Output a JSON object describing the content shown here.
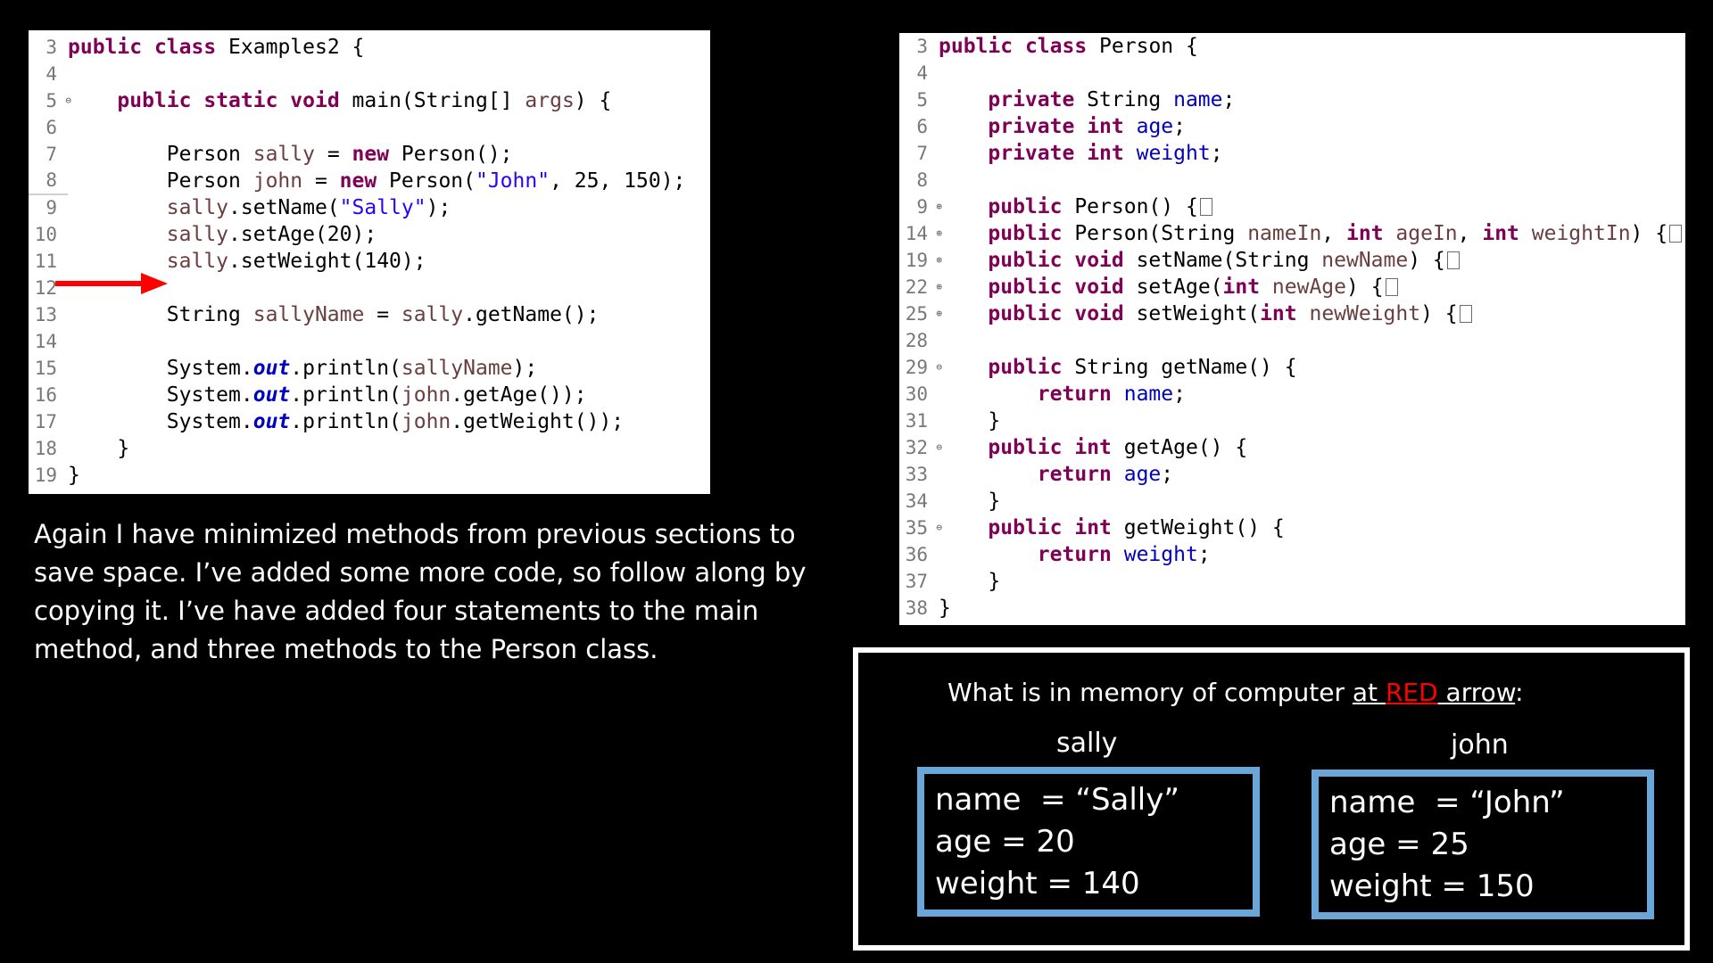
{
  "left_code": {
    "lines": [
      {
        "n": "3",
        "fold": "",
        "active": false,
        "tokens": [
          {
            "c": "kw",
            "t": "public"
          },
          {
            "c": "",
            "t": " "
          },
          {
            "c": "kw",
            "t": "class"
          },
          {
            "c": "",
            "t": " Examples2 {"
          }
        ]
      },
      {
        "n": "4",
        "fold": "",
        "active": false,
        "tokens": []
      },
      {
        "n": "5",
        "fold": "⊖",
        "active": false,
        "tokens": [
          {
            "c": "",
            "t": "    "
          },
          {
            "c": "kw",
            "t": "public"
          },
          {
            "c": "",
            "t": " "
          },
          {
            "c": "kw",
            "t": "static"
          },
          {
            "c": "",
            "t": " "
          },
          {
            "c": "kw",
            "t": "void"
          },
          {
            "c": "",
            "t": " main(String[] "
          },
          {
            "c": "var",
            "t": "args"
          },
          {
            "c": "",
            "t": ") {"
          }
        ]
      },
      {
        "n": "6",
        "fold": "",
        "active": false,
        "tokens": []
      },
      {
        "n": "7",
        "fold": "",
        "active": false,
        "tokens": [
          {
            "c": "",
            "t": "        Person "
          },
          {
            "c": "var",
            "t": "sally"
          },
          {
            "c": "",
            "t": " = "
          },
          {
            "c": "kw",
            "t": "new"
          },
          {
            "c": "",
            "t": " Person();"
          }
        ]
      },
      {
        "n": "8",
        "fold": "",
        "active": true,
        "tokens": [
          {
            "c": "",
            "t": "        Person "
          },
          {
            "c": "var",
            "t": "john"
          },
          {
            "c": "",
            "t": " = "
          },
          {
            "c": "kw",
            "t": "new"
          },
          {
            "c": "",
            "t": " Person("
          },
          {
            "c": "str",
            "t": "\"John\""
          },
          {
            "c": "",
            "t": ", 25, 150);"
          }
        ]
      },
      {
        "n": "9",
        "fold": "",
        "active": false,
        "tokens": [
          {
            "c": "",
            "t": "        "
          },
          {
            "c": "var",
            "t": "sally"
          },
          {
            "c": "",
            "t": ".setName("
          },
          {
            "c": "str",
            "t": "\"Sally\""
          },
          {
            "c": "",
            "t": ");"
          }
        ]
      },
      {
        "n": "10",
        "fold": "",
        "active": false,
        "tokens": [
          {
            "c": "",
            "t": "        "
          },
          {
            "c": "var",
            "t": "sally"
          },
          {
            "c": "",
            "t": ".setAge(20);"
          }
        ]
      },
      {
        "n": "11",
        "fold": "",
        "active": false,
        "tokens": [
          {
            "c": "",
            "t": "        "
          },
          {
            "c": "var",
            "t": "sally"
          },
          {
            "c": "",
            "t": ".setWeight(140);"
          }
        ]
      },
      {
        "n": "12",
        "fold": "",
        "active": false,
        "tokens": []
      },
      {
        "n": "13",
        "fold": "",
        "active": false,
        "tokens": [
          {
            "c": "",
            "t": "        String "
          },
          {
            "c": "var",
            "t": "sallyName"
          },
          {
            "c": "",
            "t": " = "
          },
          {
            "c": "var",
            "t": "sally"
          },
          {
            "c": "",
            "t": ".getName();"
          }
        ]
      },
      {
        "n": "14",
        "fold": "",
        "active": false,
        "tokens": []
      },
      {
        "n": "15",
        "fold": "",
        "active": false,
        "tokens": [
          {
            "c": "",
            "t": "        System."
          },
          {
            "c": "sfld",
            "t": "out"
          },
          {
            "c": "",
            "t": ".println("
          },
          {
            "c": "var",
            "t": "sallyName"
          },
          {
            "c": "",
            "t": ");"
          }
        ]
      },
      {
        "n": "16",
        "fold": "",
        "active": false,
        "tokens": [
          {
            "c": "",
            "t": "        System."
          },
          {
            "c": "sfld",
            "t": "out"
          },
          {
            "c": "",
            "t": ".println("
          },
          {
            "c": "var",
            "t": "john"
          },
          {
            "c": "",
            "t": ".getAge());"
          }
        ]
      },
      {
        "n": "17",
        "fold": "",
        "active": false,
        "tokens": [
          {
            "c": "",
            "t": "        System."
          },
          {
            "c": "sfld",
            "t": "out"
          },
          {
            "c": "",
            "t": ".println("
          },
          {
            "c": "var",
            "t": "john"
          },
          {
            "c": "",
            "t": ".getWeight());"
          }
        ]
      },
      {
        "n": "18",
        "fold": "",
        "active": false,
        "tokens": [
          {
            "c": "",
            "t": "    }"
          }
        ]
      },
      {
        "n": "19",
        "fold": "",
        "active": false,
        "tokens": [
          {
            "c": "",
            "t": "}"
          }
        ]
      }
    ]
  },
  "right_code": {
    "lines": [
      {
        "n": "3",
        "fold": "",
        "tokens": [
          {
            "c": "kw",
            "t": "public"
          },
          {
            "c": "",
            "t": " "
          },
          {
            "c": "kw",
            "t": "class"
          },
          {
            "c": "",
            "t": " Person {"
          }
        ]
      },
      {
        "n": "4",
        "fold": "",
        "tokens": []
      },
      {
        "n": "5",
        "fold": "",
        "tokens": [
          {
            "c": "",
            "t": "    "
          },
          {
            "c": "kw",
            "t": "private"
          },
          {
            "c": "",
            "t": " String "
          },
          {
            "c": "fld",
            "t": "name"
          },
          {
            "c": "",
            "t": ";"
          }
        ]
      },
      {
        "n": "6",
        "fold": "",
        "tokens": [
          {
            "c": "",
            "t": "    "
          },
          {
            "c": "kw",
            "t": "private"
          },
          {
            "c": "",
            "t": " "
          },
          {
            "c": "kw",
            "t": "int"
          },
          {
            "c": "",
            "t": " "
          },
          {
            "c": "fld",
            "t": "age"
          },
          {
            "c": "",
            "t": ";"
          }
        ]
      },
      {
        "n": "7",
        "fold": "",
        "tokens": [
          {
            "c": "",
            "t": "    "
          },
          {
            "c": "kw",
            "t": "private"
          },
          {
            "c": "",
            "t": " "
          },
          {
            "c": "kw",
            "t": "int"
          },
          {
            "c": "",
            "t": " "
          },
          {
            "c": "fld",
            "t": "weight"
          },
          {
            "c": "",
            "t": ";"
          }
        ]
      },
      {
        "n": "8",
        "fold": "",
        "tokens": []
      },
      {
        "n": "9",
        "fold": "⊕",
        "tokens": [
          {
            "c": "",
            "t": "    "
          },
          {
            "c": "kw",
            "t": "public"
          },
          {
            "c": "",
            "t": " Person() {"
          },
          {
            "c": "box",
            "t": ""
          }
        ]
      },
      {
        "n": "14",
        "fold": "⊕",
        "tokens": [
          {
            "c": "",
            "t": "    "
          },
          {
            "c": "kw",
            "t": "public"
          },
          {
            "c": "",
            "t": " Person(String "
          },
          {
            "c": "var",
            "t": "nameIn"
          },
          {
            "c": "",
            "t": ", "
          },
          {
            "c": "kw",
            "t": "int"
          },
          {
            "c": "",
            "t": " "
          },
          {
            "c": "var",
            "t": "ageIn"
          },
          {
            "c": "",
            "t": ", "
          },
          {
            "c": "kw",
            "t": "int"
          },
          {
            "c": "",
            "t": " "
          },
          {
            "c": "var",
            "t": "weightIn"
          },
          {
            "c": "",
            "t": ") {"
          },
          {
            "c": "box",
            "t": ""
          }
        ]
      },
      {
        "n": "19",
        "fold": "⊕",
        "tokens": [
          {
            "c": "",
            "t": "    "
          },
          {
            "c": "kw",
            "t": "public"
          },
          {
            "c": "",
            "t": " "
          },
          {
            "c": "kw",
            "t": "void"
          },
          {
            "c": "",
            "t": " setName(String "
          },
          {
            "c": "var",
            "t": "newName"
          },
          {
            "c": "",
            "t": ") {"
          },
          {
            "c": "box",
            "t": ""
          }
        ]
      },
      {
        "n": "22",
        "fold": "⊕",
        "tokens": [
          {
            "c": "",
            "t": "    "
          },
          {
            "c": "kw",
            "t": "public"
          },
          {
            "c": "",
            "t": " "
          },
          {
            "c": "kw",
            "t": "void"
          },
          {
            "c": "",
            "t": " setAge("
          },
          {
            "c": "kw",
            "t": "int"
          },
          {
            "c": "",
            "t": " "
          },
          {
            "c": "var",
            "t": "newAge"
          },
          {
            "c": "",
            "t": ") {"
          },
          {
            "c": "box",
            "t": ""
          }
        ]
      },
      {
        "n": "25",
        "fold": "⊕",
        "tokens": [
          {
            "c": "",
            "t": "    "
          },
          {
            "c": "kw",
            "t": "public"
          },
          {
            "c": "",
            "t": " "
          },
          {
            "c": "kw",
            "t": "void"
          },
          {
            "c": "",
            "t": " setWeight("
          },
          {
            "c": "kw",
            "t": "int"
          },
          {
            "c": "",
            "t": " "
          },
          {
            "c": "var",
            "t": "newWeight"
          },
          {
            "c": "",
            "t": ") {"
          },
          {
            "c": "box",
            "t": ""
          }
        ]
      },
      {
        "n": "28",
        "fold": "",
        "tokens": []
      },
      {
        "n": "29",
        "fold": "⊖",
        "tokens": [
          {
            "c": "",
            "t": "    "
          },
          {
            "c": "kw",
            "t": "public"
          },
          {
            "c": "",
            "t": " String getName() {"
          }
        ]
      },
      {
        "n": "30",
        "fold": "",
        "tokens": [
          {
            "c": "",
            "t": "        "
          },
          {
            "c": "kw",
            "t": "return"
          },
          {
            "c": "",
            "t": " "
          },
          {
            "c": "fld",
            "t": "name"
          },
          {
            "c": "",
            "t": ";"
          }
        ]
      },
      {
        "n": "31",
        "fold": "",
        "tokens": [
          {
            "c": "",
            "t": "    }"
          }
        ]
      },
      {
        "n": "32",
        "fold": "⊖",
        "tokens": [
          {
            "c": "",
            "t": "    "
          },
          {
            "c": "kw",
            "t": "public"
          },
          {
            "c": "",
            "t": " "
          },
          {
            "c": "kw",
            "t": "int"
          },
          {
            "c": "",
            "t": " getAge() {"
          }
        ]
      },
      {
        "n": "33",
        "fold": "",
        "tokens": [
          {
            "c": "",
            "t": "        "
          },
          {
            "c": "kw",
            "t": "return"
          },
          {
            "c": "",
            "t": " "
          },
          {
            "c": "fld",
            "t": "age"
          },
          {
            "c": "",
            "t": ";"
          }
        ]
      },
      {
        "n": "34",
        "fold": "",
        "tokens": [
          {
            "c": "",
            "t": "    }"
          }
        ]
      },
      {
        "n": "35",
        "fold": "⊖",
        "tokens": [
          {
            "c": "",
            "t": "    "
          },
          {
            "c": "kw",
            "t": "public"
          },
          {
            "c": "",
            "t": " "
          },
          {
            "c": "kw",
            "t": "int"
          },
          {
            "c": "",
            "t": " getWeight() {"
          }
        ]
      },
      {
        "n": "36",
        "fold": "",
        "tokens": [
          {
            "c": "",
            "t": "        "
          },
          {
            "c": "kw",
            "t": "return"
          },
          {
            "c": "",
            "t": " "
          },
          {
            "c": "fld",
            "t": "weight"
          },
          {
            "c": "",
            "t": ";"
          }
        ]
      },
      {
        "n": "37",
        "fold": "",
        "tokens": [
          {
            "c": "",
            "t": "    }"
          }
        ]
      },
      {
        "n": "38",
        "fold": "",
        "tokens": [
          {
            "c": "",
            "t": "}"
          }
        ]
      }
    ]
  },
  "explanation": "Again I have minimized methods from previous sections to save space. I’ve added some more code, so follow along by copying it.  I’ve have added four statements to the main method, and three methods to the Person class.",
  "memory": {
    "title_pre": "What is in memory of computer ",
    "title_at": "at ",
    "title_red": "RED",
    "title_post": " arrow",
    "title_colon": ":",
    "sally": {
      "label": "sally",
      "name": "name  = “Sally”",
      "age": "age = 20",
      "weight": "weight = 140"
    },
    "john": {
      "label": "john",
      "name": "name  = “John”",
      "age": "age = 25",
      "weight": "weight = 150"
    }
  },
  "colors": {
    "keyword": "#7f0055",
    "string": "#2a00ff",
    "field": "#0000c0",
    "arrow": "#ff0000",
    "box_border": "#6aa6d8"
  },
  "icons": {
    "arrow": "red-arrow-icon",
    "fold_collapsed": "fold-expand-icon",
    "fold_expanded": "fold-collapse-icon"
  }
}
